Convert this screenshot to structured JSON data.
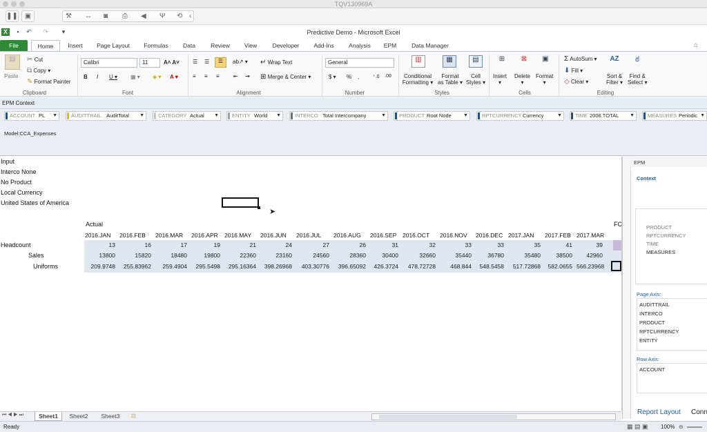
{
  "mac": {
    "title": "TQV130969A"
  },
  "excel": {
    "window_title": "Predictive Demo - Microsoft Excel"
  },
  "tabs": [
    "File",
    "Home",
    "Insert",
    "Page Layout",
    "Formulas",
    "Data",
    "Review",
    "View",
    "Developer",
    "Add-Ins",
    "Analysis",
    "EPM",
    "Data Manager"
  ],
  "ribbon": {
    "clipboard": {
      "paste": "Paste",
      "cut": "Cut",
      "copy": "Copy",
      "format_painter": "Format Painter",
      "label": "Clipboard"
    },
    "font": {
      "name": "Calibri",
      "size": "11",
      "label": "Font"
    },
    "alignment": {
      "wrap": "Wrap Text",
      "merge": "Merge & Center",
      "label": "Alignment"
    },
    "number": {
      "format": "General",
      "dollar": "$",
      "percent": "%",
      "label": "Number"
    },
    "styles": {
      "conditional": [
        "Conditional",
        "Formatting"
      ],
      "table": [
        "Format",
        "as Table"
      ],
      "cell": [
        "Cell",
        "Styles"
      ],
      "label": "Styles"
    },
    "cells": {
      "insert": "Insert",
      "delete": "Delete",
      "format": "Format",
      "label": "Cells"
    },
    "editing": {
      "autosum": "AutoSum",
      "fill": "Fill",
      "clear": "Clear",
      "sort": [
        "Sort &",
        "Filter"
      ],
      "find": [
        "Find &",
        "Select"
      ],
      "label": "Editing"
    }
  },
  "epm_context": {
    "title": "EPM Context",
    "model": "Model:CCA_Expenses",
    "dims": [
      {
        "name": "ACCOUNT",
        "value": "PL",
        "color": "#1f4e8c"
      },
      {
        "name": "AUDITTRAIL",
        "value": "AuditTotal",
        "color": "#e8b820"
      },
      {
        "name": "CATEGORY",
        "value": "Actual",
        "color": "#c8c8c8"
      },
      {
        "name": "ENTITY",
        "value": "World",
        "color": "#a0a0a0"
      },
      {
        "name": "INTERCO",
        "value": "Total Intercompany",
        "color": "#707070"
      },
      {
        "name": "PRODUCT",
        "value": "Root Node",
        "color": "#1f4e8c"
      },
      {
        "name": "RPTCURRENCY",
        "value": "Currency",
        "color": "#1f4e8c"
      },
      {
        "name": "TIME",
        "value": "2006.TOTAL",
        "color": "#1f4e8c"
      },
      {
        "name": "MEASURES",
        "value": "Periodic",
        "color": "#1f4e8c"
      }
    ]
  },
  "sheet": {
    "page_axis": [
      "Input",
      "Interco None",
      "No Product",
      "Local Currency",
      "United States of America"
    ],
    "category_label": "Actual",
    "fc_label": "FC",
    "periods": [
      "2016.JAN",
      "2016.FEB",
      "2016.MAR",
      "2016.APR",
      "2016.MAY",
      "2016.JUN",
      "2016.JUL",
      "2016.AUG",
      "2016.SEP",
      "2016.OCT",
      "2016.NOV",
      "2016.DEC",
      "2017.JAN",
      "2017.FEB",
      "2017.MAR"
    ],
    "rows": [
      {
        "label": "Headcount",
        "values": [
          "13",
          "16",
          "17",
          "19",
          "21",
          "24",
          "27",
          "26",
          "31",
          "32",
          "33",
          "33",
          "35",
          "41",
          "39"
        ]
      },
      {
        "label": "Sales",
        "values": [
          "13800",
          "15820",
          "18480",
          "19800",
          "22360",
          "23160",
          "24560",
          "28360",
          "30400",
          "32660",
          "35440",
          "36780",
          "35480",
          "38500",
          "42960"
        ]
      },
      {
        "label": "Uniforms",
        "values": [
          "209.9748",
          "255.83962",
          "259.4904",
          "295.5498",
          "295.16364",
          "398.26968",
          "403.30776",
          "396.65092",
          "426.3724",
          "478.72728",
          "468.844",
          "548.5458",
          "517.72868",
          "582.0655",
          "566.23968"
        ]
      }
    ]
  },
  "pane": {
    "title": "EPM",
    "context": "Context",
    "context_items": [
      "PRODUCT",
      "RPTCURRENCY",
      "TIME",
      "MEASURES"
    ],
    "page_axis_label": "Page Axis:",
    "page_axis": [
      "AUDITTRAIL",
      "INTERCO",
      "PRODUCT",
      "RPTCURRENCY",
      "ENTITY"
    ],
    "row_axis_label": "Row Axis:",
    "row_axis": [
      "ACCOUNT"
    ],
    "report_layout": "Report Layout",
    "conn": "Conn"
  },
  "sheets": [
    "Sheet1",
    "Sheet2",
    "Sheet3"
  ],
  "status": {
    "ready": "Ready",
    "zoom": "100%"
  }
}
